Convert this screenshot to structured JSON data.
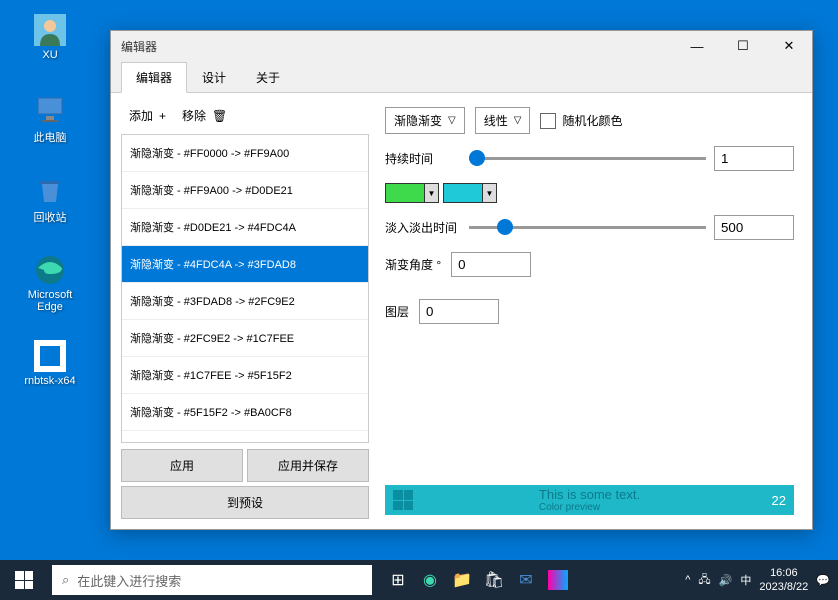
{
  "desktop": {
    "icons": [
      {
        "name": "XU"
      },
      {
        "name": "此电脑"
      },
      {
        "name": "回收站"
      },
      {
        "name": "Microsoft Edge"
      },
      {
        "name": "rnbtsk-x64"
      }
    ]
  },
  "window": {
    "title": "编辑器",
    "tabs": [
      "编辑器",
      "设计",
      "关于"
    ],
    "active_tab": 0,
    "toolbar": {
      "add": "添加",
      "remove": "移除"
    },
    "list_items": [
      "渐隐渐变 - #FF0000 -> #FF9A00",
      "渐隐渐变 - #FF9A00 -> #D0DE21",
      "渐隐渐变 - #D0DE21 -> #4FDC4A",
      "渐隐渐变 - #4FDC4A -> #3FDAD8",
      "渐隐渐变 - #3FDAD8 -> #2FC9E2",
      "渐隐渐变 - #2FC9E2 -> #1C7FEE",
      "渐隐渐变 - #1C7FEE -> #5F15F2",
      "渐隐渐变 - #5F15F2 -> #BA0CF8"
    ],
    "selected_index": 3,
    "buttons": {
      "apply": "应用",
      "apply_save": "应用并保存",
      "to_preset": "到预设"
    },
    "right": {
      "gradient_type": "渐隐渐变",
      "curve": "线性",
      "randomize": "随机化颜色",
      "duration_label": "持续时间",
      "duration_value": "1",
      "color1": "#3FD94C",
      "color2": "#1FC9D8",
      "fade_label": "淡入淡出时间",
      "fade_value": "500",
      "angle_label": "渐变角度 °",
      "angle_value": "0",
      "layer_label": "图层",
      "layer_value": "0",
      "preview_text": "This is some text.",
      "preview_sub": "Color preview",
      "preview_num": "22"
    }
  },
  "taskbar": {
    "search_placeholder": "在此键入进行搜索",
    "ime": "中",
    "time": "16:06",
    "date": "2023/8/22"
  }
}
